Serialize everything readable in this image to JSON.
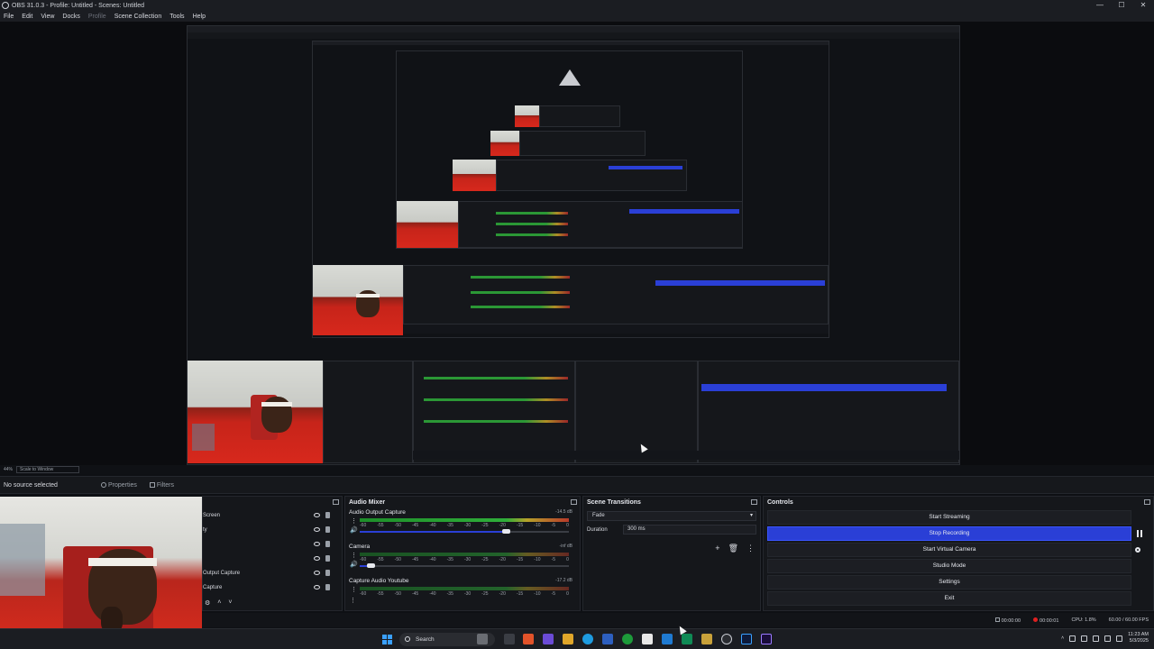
{
  "window": {
    "title": "OBS 31.0.3 - Profile: Untitled - Scenes: Untitled",
    "controls": [
      "—",
      "☐",
      "✕"
    ]
  },
  "menu": {
    "file": "File",
    "edit": "Edit",
    "view": "View",
    "docks": "Docks",
    "profile": "Profile",
    "scene_collection": "Scene Collection",
    "tools": "Tools",
    "help": "Help"
  },
  "preview_toolbar": {
    "zoom_pct": "44%",
    "scale_select": "Scale to Window"
  },
  "source_toolbar": {
    "no_source": "No source selected",
    "properties": "Properties",
    "filters": "Filters"
  },
  "sources": {
    "items": [
      "Screen",
      "ty",
      "",
      "",
      "Output Capture",
      "Capture"
    ],
    "tools": [
      "⚙",
      "˄",
      "˅"
    ]
  },
  "audio_mixer": {
    "title": "Audio Mixer",
    "channels": [
      {
        "name": "Audio Output Capture",
        "db": "-14.5 dB",
        "volume": 0.7
      },
      {
        "name": "Camera",
        "db": "-inf dB",
        "volume": 0.05
      },
      {
        "name": "Capture Audio Youtube",
        "db": "-17.2 dB",
        "volume": 0.05
      }
    ],
    "ticks": [
      "-60",
      "-55",
      "-50",
      "-45",
      "-40",
      "-35",
      "-30",
      "-25",
      "-20",
      "-15",
      "-10",
      "-5",
      "0"
    ]
  },
  "scene_transitions": {
    "title": "Scene Transitions",
    "selected": "Fade",
    "duration_label": "Duration",
    "duration_value": "300 ms"
  },
  "controls": {
    "title": "Controls",
    "start_streaming": "Start Streaming",
    "stop_recording": "Stop Recording",
    "start_virtual_camera": "Start Virtual Camera",
    "studio_mode": "Studio Mode",
    "settings": "Settings",
    "exit": "Exit"
  },
  "status": {
    "stream_time": "00:00:00",
    "rec_time": "00:00:01",
    "cpu": "CPU: 1.8%",
    "fps": "60.00 / 60.00 FPS"
  },
  "taskbar": {
    "search": "Search",
    "time": "11:23 AM",
    "date": "5/3/2025"
  },
  "colors": {
    "accent": "#2a3fd6",
    "panel": "#15171b",
    "background": "#0e1014"
  }
}
